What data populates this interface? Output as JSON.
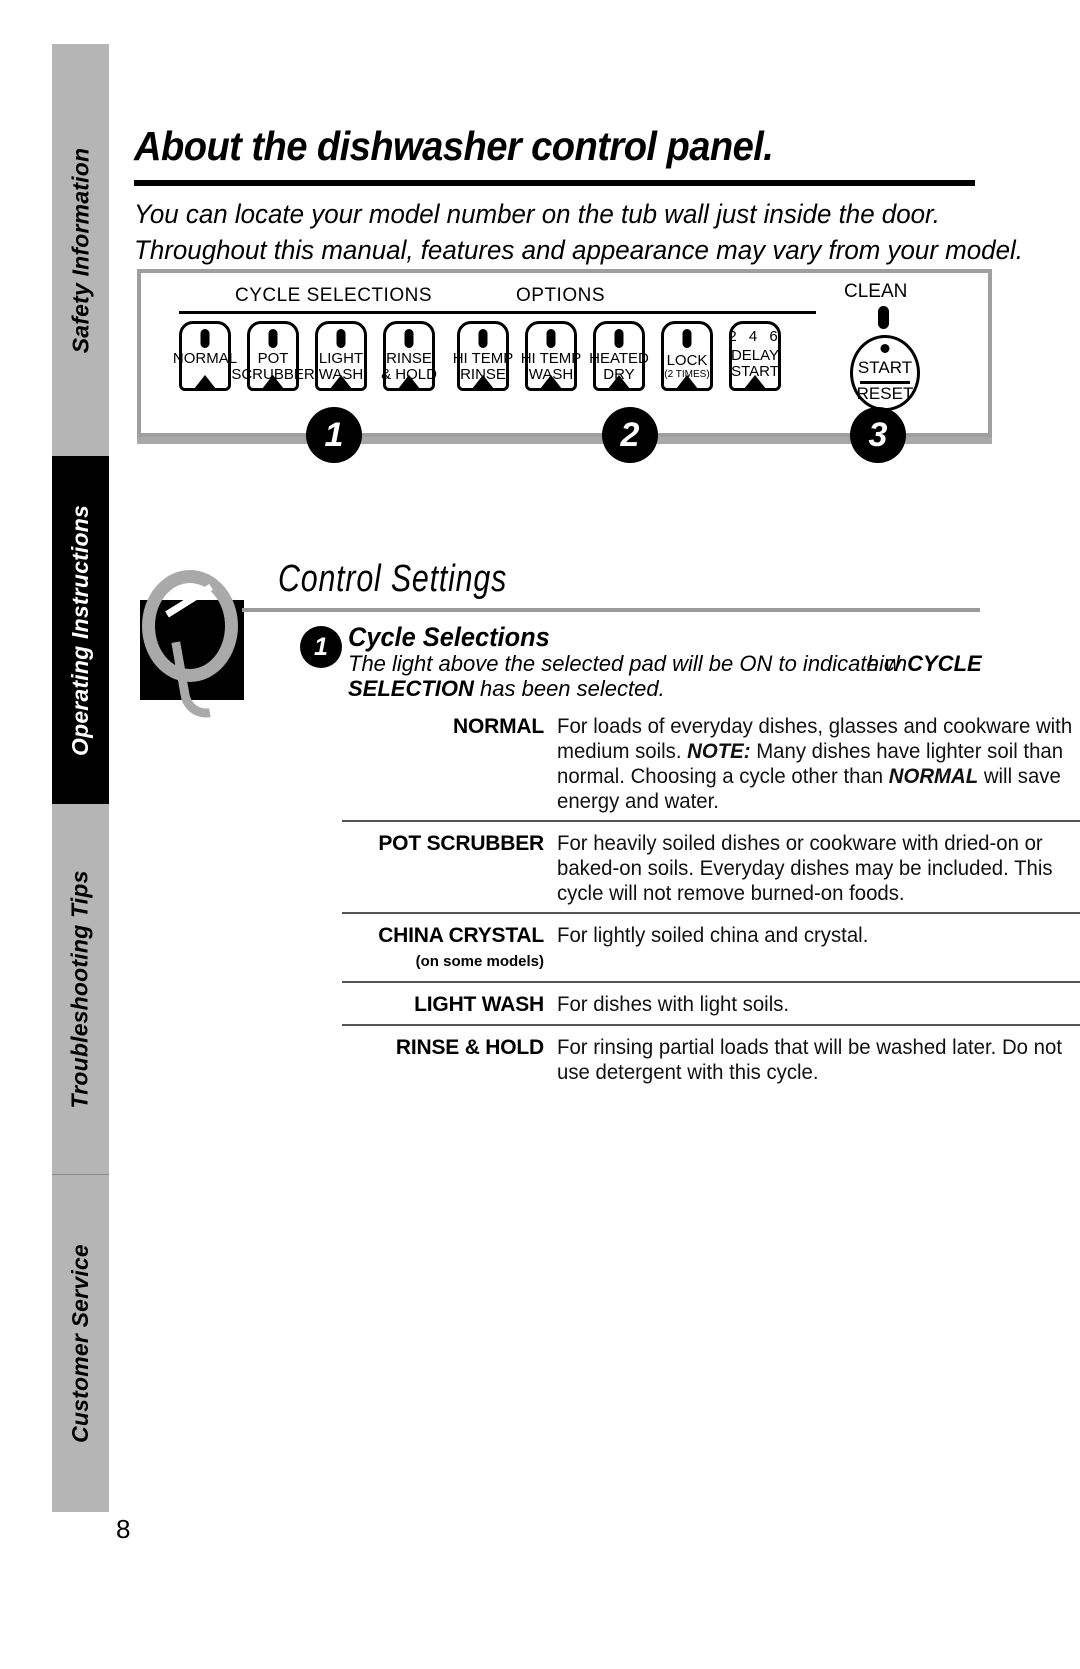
{
  "sidebar": {
    "items": [
      {
        "label": "Safety Information",
        "style": "gray"
      },
      {
        "label": "Operating Instructions",
        "style": "black"
      },
      {
        "label": "Troubleshooting Tips",
        "style": "gray"
      },
      {
        "label": "Customer Service",
        "style": "gray"
      }
    ]
  },
  "header": {
    "title": "About the dishwasher control panel.",
    "intro_line1": "You can locate your model number on the tub wall just inside the door.",
    "intro_line2": "Throughout this manual, features and appearance may vary from your model."
  },
  "control_panel": {
    "group_cycle_selections": "CYCLE SELECTIONS",
    "group_options": "OPTIONS",
    "clean_label": "CLEAN",
    "cycle_pads": [
      {
        "line1": "NORMAL",
        "line2": ""
      },
      {
        "line1": "POT",
        "line2": "SCRUBBER"
      },
      {
        "line1": "LIGHT",
        "line2": "WASH"
      },
      {
        "line1": "RINSE",
        "line2": "& HOLD"
      }
    ],
    "option_pads": [
      {
        "line1": "HI TEMP",
        "line2": "RINSE",
        "sub": ""
      },
      {
        "line1": "HI TEMP",
        "line2": "WASH",
        "sub": ""
      },
      {
        "line1": "HEATED",
        "line2": "DRY",
        "sub": ""
      },
      {
        "line1": "LOCK",
        "line2": "",
        "sub": "(2 TIMES)"
      },
      {
        "line1": "DELAY",
        "line2": "START",
        "sub": "",
        "numbers": "2 4 6"
      }
    ],
    "start_button": {
      "top": "START",
      "bottom": "RESET"
    },
    "callouts": [
      "1",
      "2",
      "3"
    ]
  },
  "control_settings": {
    "section_title": "Control Settings",
    "bullet": "1",
    "heading": "Cycle Selections",
    "sub_part1": "The light above the selected pad will be ON to indicate w",
    "sub_overlap": "hich",
    "sub_bold1": "CYCLE",
    "sub_bold2": "SELECTION",
    "sub_part2": " has been selected.",
    "rows": [
      {
        "label": "NORMAL",
        "sublabel": "",
        "desc_1": "For loads of everyday dishes, glasses and cookware with medium soils. ",
        "desc_bold_1": "NOTE:",
        "desc_2": " Many dishes have lighter soil than normal. Choosing a cycle other than ",
        "desc_bold_2": "NORMAL",
        "desc_3": " will save energy and water."
      },
      {
        "label": "POT SCRUBBER",
        "sublabel": "",
        "desc_1": "For heavily soiled dishes or cookware with dried-on or baked-on soils. Everyday dishes may be included. This cycle will not remove burned-on foods.",
        "desc_bold_1": "",
        "desc_2": "",
        "desc_bold_2": "",
        "desc_3": ""
      },
      {
        "label": "CHINA CRYSTAL",
        "sublabel": "(on some models)",
        "desc_1": "For lightly soiled china and crystal.",
        "desc_bold_1": "",
        "desc_2": "",
        "desc_bold_2": "",
        "desc_3": ""
      },
      {
        "label": "LIGHT WASH",
        "sublabel": "",
        "desc_1": "For dishes with light soils.",
        "desc_bold_1": "",
        "desc_2": "",
        "desc_bold_2": "",
        "desc_3": ""
      },
      {
        "label": "RINSE & HOLD",
        "sublabel": "",
        "desc_1": "For rinsing partial loads that will be washed later. Do not use detergent with this cycle.",
        "desc_bold_1": "",
        "desc_2": "",
        "desc_bold_2": "",
        "desc_3": ""
      }
    ]
  },
  "footer": {
    "page_number": "8"
  },
  "colors": {
    "rail_gray": "#b5b5b5",
    "rail_black": "#000000",
    "panel_border": "#9f9f9f",
    "rule_gray": "#9a9a9a"
  }
}
